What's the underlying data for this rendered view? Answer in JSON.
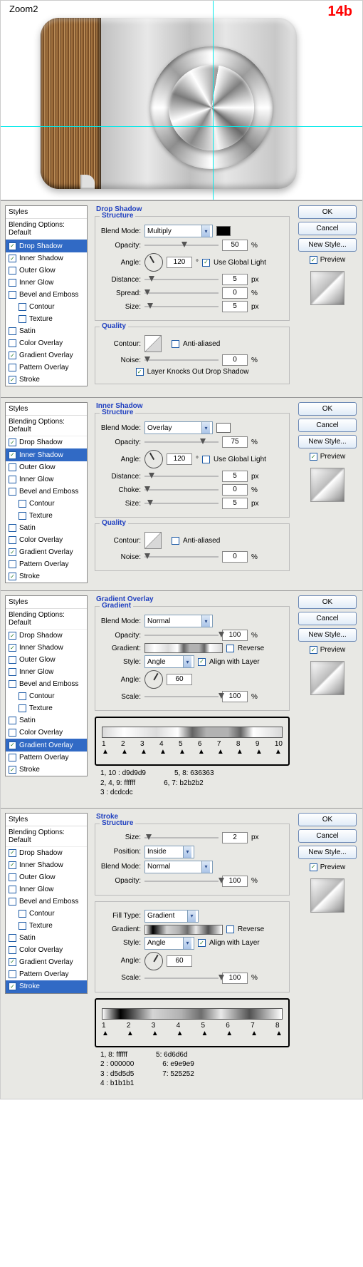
{
  "top": {
    "zoom": "Zoom2",
    "tag": "14b"
  },
  "buttons": {
    "ok": "OK",
    "cancel": "Cancel",
    "newstyle": "New Style...",
    "preview": "Preview"
  },
  "styles_hdr": "Styles",
  "blending": "Blending Options: Default",
  "effects": {
    "drop": "Drop Shadow",
    "inner": "Inner Shadow",
    "oglow": "Outer Glow",
    "iglow": "Inner Glow",
    "bevel": "Bevel and Emboss",
    "contour": "Contour",
    "texture": "Texture",
    "satin": "Satin",
    "cov": "Color Overlay",
    "gov": "Gradient Overlay",
    "pov": "Pattern Overlay",
    "stroke": "Stroke"
  },
  "labels": {
    "structure": "Structure",
    "quality": "Quality",
    "gradient_sec": "Gradient",
    "blendmode": "Blend Mode:",
    "opacity": "Opacity:",
    "angle": "Angle:",
    "distance": "Distance:",
    "spread": "Spread:",
    "choke": "Choke:",
    "size": "Size:",
    "contour": "Contour:",
    "noise": "Noise:",
    "antialiased": "Anti-aliased",
    "useglobal": "Use Global Light",
    "knockout": "Layer Knocks Out Drop Shadow",
    "gradient": "Gradient:",
    "style": "Style:",
    "reverse": "Reverse",
    "align": "Align with Layer",
    "scale": "Scale:",
    "position": "Position:",
    "filltype": "Fill Type:"
  },
  "panel1": {
    "title": "Drop Shadow",
    "mode": "Multiply",
    "swatch": "#000000",
    "opacity": "50",
    "angle": "120",
    "globallight": true,
    "distance": "5",
    "spread": "0",
    "size": "5",
    "noise": "0"
  },
  "panel2": {
    "title": "Inner Shadow",
    "mode": "Overlay",
    "swatch": "#ffffff",
    "opacity": "75",
    "angle": "120",
    "globallight": false,
    "distance": "5",
    "choke": "0",
    "size": "5",
    "noise": "0"
  },
  "panel3": {
    "title": "Gradient Overlay",
    "mode": "Normal",
    "opacity": "100",
    "style": "Angle",
    "reverse": false,
    "align": true,
    "angle": "60",
    "scale": "100",
    "stops": [
      "1",
      "2",
      "3",
      "4",
      "5",
      "6",
      "7",
      "8",
      "9",
      "10"
    ],
    "gradient_css": "linear-gradient(to right,#d9d9d9 0%,#ffffff 12%,#dcdcdc 30%,#ffffff 42%,#636363 50%,#b2b2b2 58%,#b2b2b2 70%,#636363 77%,#ffffff 84%,#d9d9d9 100%)",
    "legend": {
      "l1a": "1, 10 : d9d9d9",
      "l1b": "5, 8: 636363",
      "l2a": "2, 4, 9: ffffff",
      "l2b": "6, 7: b2b2b2",
      "l3a": "3      : dcdcdc"
    }
  },
  "panel4": {
    "title": "Stroke",
    "size": "2",
    "position": "Inside",
    "mode": "Normal",
    "opacity": "100",
    "filltype": "Gradient",
    "style": "Angle",
    "reverse": false,
    "align": true,
    "angle": "60",
    "scale": "100",
    "stops": [
      "1",
      "2",
      "3",
      "4",
      "5",
      "6",
      "7",
      "8"
    ],
    "gradient_css": "linear-gradient(to right,#ffffff 0%,#000000 10%,#d5d5d5 28%,#b1b1b1 44%,#6d6d6d 55%,#e9e9e9 66%,#525252 82%,#ffffff 100%)",
    "legend": {
      "l1a": "1, 8: ffffff",
      "l1b": "5: 6d6d6d",
      "l2a": "2   : 000000",
      "l2b": "6: e9e9e9",
      "l3a": "3   : d5d5d5",
      "l3b": "7: 525252",
      "l4a": "4   : b1b1b1"
    }
  },
  "units": {
    "pct": "%",
    "px": "px",
    "deg": "°"
  }
}
